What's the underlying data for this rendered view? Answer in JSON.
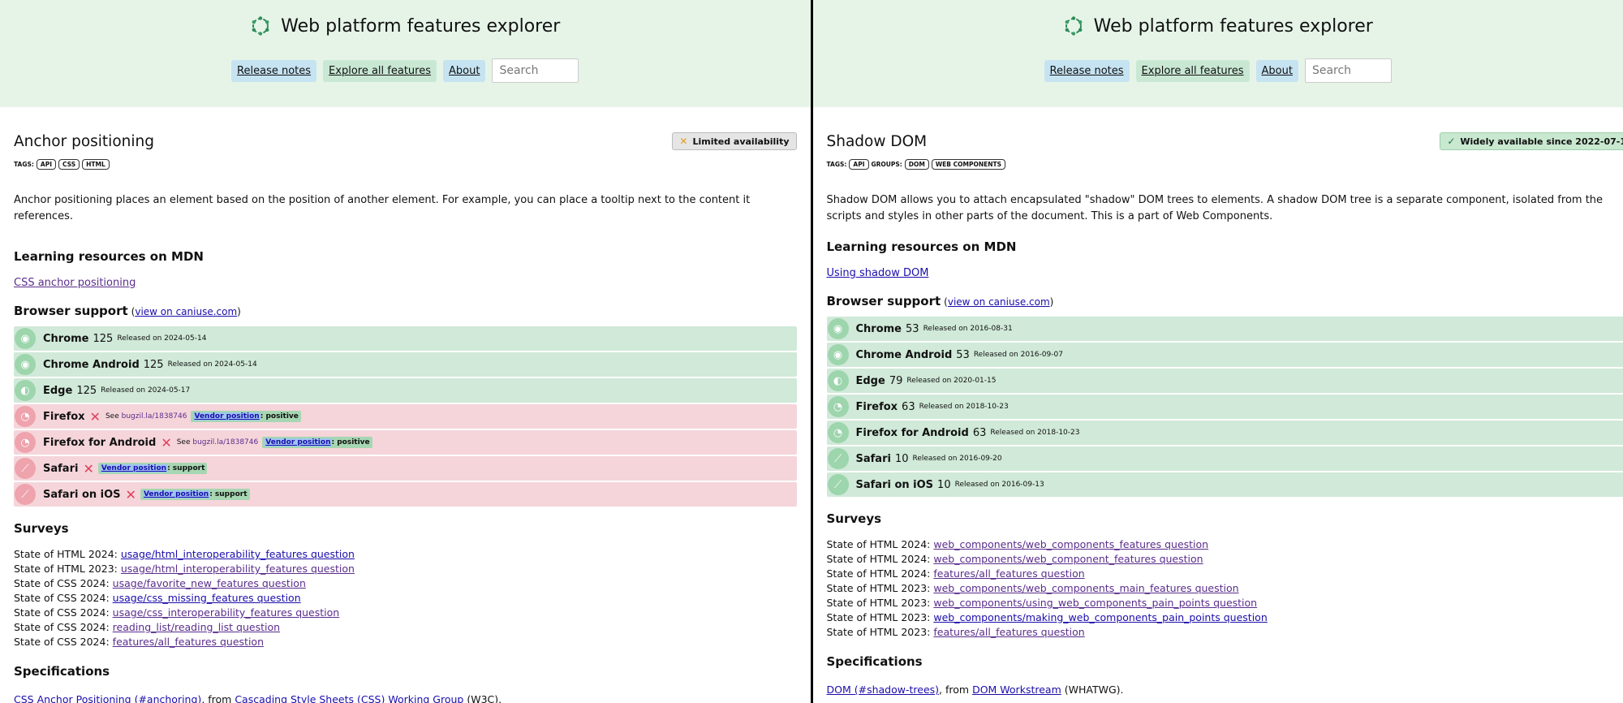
{
  "left": {
    "brand": "Web platform features explorer",
    "nav": {
      "release_notes": "Release notes",
      "explore": "Explore all features",
      "about": "About",
      "search_placeholder": "Search"
    },
    "feature": {
      "title": "Anchor positioning",
      "badge": "Limited availability",
      "tags_label": "TAGS:",
      "tags": [
        "API",
        "CSS",
        "HTML"
      ],
      "description": "Anchor positioning places an element based on the position of another element. For example, you can place a tooltip next to the content it references."
    },
    "mdn": {
      "heading": "Learning resources on MDN",
      "link": "CSS anchor positioning"
    },
    "support": {
      "heading": "Browser support",
      "paren_open": "(",
      "caniuse": "view on caniuse.com",
      "paren_close": ")",
      "browsers": [
        {
          "name": "Chrome",
          "version": "125",
          "released": "Released on 2024-05-14"
        },
        {
          "name": "Chrome Android",
          "version": "125",
          "released": "Released on 2024-05-14"
        },
        {
          "name": "Edge",
          "version": "125",
          "released": "Released on 2024-05-17"
        },
        {
          "name": "Firefox",
          "x": "✕",
          "see": "See",
          "bug": "bugzil.la/1838746",
          "vendor": "Vendor position",
          "position": ": positive"
        },
        {
          "name": "Firefox for Android",
          "x": "✕",
          "see": "See",
          "bug": "bugzil.la/1838746",
          "vendor": "Vendor position",
          "position": ": positive"
        },
        {
          "name": "Safari",
          "x": "✕",
          "vendor": "Vendor position",
          "position": ": support"
        },
        {
          "name": "Safari on iOS",
          "x": "✕",
          "vendor": "Vendor position",
          "position": ": support"
        }
      ]
    },
    "surveys": {
      "heading": "Surveys",
      "items": [
        {
          "label": "State of HTML 2024:",
          "link": "usage/html_interoperability_features question"
        },
        {
          "label": "State of HTML 2023:",
          "link": "usage/html_interoperability_features question"
        },
        {
          "label": "State of CSS 2024:",
          "link": "usage/favorite_new_features question"
        },
        {
          "label": "State of CSS 2024:",
          "link": "usage/css_missing_features question"
        },
        {
          "label": "State of CSS 2024:",
          "link": "usage/css_interoperability_features question"
        },
        {
          "label": "State of CSS 2024:",
          "link": "reading_list/reading_list question"
        },
        {
          "label": "State of CSS 2024:",
          "link": "features/all_features question"
        }
      ]
    },
    "specs": {
      "heading": "Specifications",
      "link": "CSS Anchor Positioning (#anchoring)",
      "from": ", from",
      "group": "Cascading Style Sheets (CSS) Working Group",
      "org": "(W3C)."
    }
  },
  "right": {
    "brand": "Web platform features explorer",
    "nav": {
      "release_notes": "Release notes",
      "explore": "Explore all features",
      "about": "About",
      "search_placeholder": "Search"
    },
    "feature": {
      "title": "Shadow DOM",
      "badge": "Widely available since 2022-07-1",
      "tags_label": "TAGS:",
      "tags": [
        "API"
      ],
      "groups_label": "GROUPS:",
      "groups": [
        "DOM",
        "WEB COMPONENTS"
      ],
      "description": "Shadow DOM allows you to attach encapsulated \"shadow\" DOM trees to elements. A shadow DOM tree is a separate component, isolated from the scripts and styles in other parts of the document. This is a part of Web Components."
    },
    "mdn": {
      "heading": "Learning resources on MDN",
      "link": "Using shadow DOM"
    },
    "support": {
      "heading": "Browser support",
      "paren_open": "(",
      "caniuse": "view on caniuse.com",
      "paren_close": ")",
      "browsers": [
        {
          "name": "Chrome",
          "version": "53",
          "released": "Released on 2016-08-31"
        },
        {
          "name": "Chrome Android",
          "version": "53",
          "released": "Released on 2016-09-07"
        },
        {
          "name": "Edge",
          "version": "79",
          "released": "Released on 2020-01-15"
        },
        {
          "name": "Firefox",
          "version": "63",
          "released": "Released on 2018-10-23"
        },
        {
          "name": "Firefox for Android",
          "version": "63",
          "released": "Released on 2018-10-23"
        },
        {
          "name": "Safari",
          "version": "10",
          "released": "Released on 2016-09-20"
        },
        {
          "name": "Safari on iOS",
          "version": "10",
          "released": "Released on 2016-09-13"
        }
      ]
    },
    "surveys": {
      "heading": "Surveys",
      "items": [
        {
          "label": "State of HTML 2024:",
          "link": "web_components/web_components_features question"
        },
        {
          "label": "State of HTML 2024:",
          "link": "web_components/web_component_features question"
        },
        {
          "label": "State of HTML 2024:",
          "link": "features/all_features question"
        },
        {
          "label": "State of HTML 2023:",
          "link": "web_components/web_components_main_features question"
        },
        {
          "label": "State of HTML 2023:",
          "link": "web_components/using_web_components_pain_points question"
        },
        {
          "label": "State of HTML 2023:",
          "link": "web_components/making_web_components_pain_points question"
        },
        {
          "label": "State of HTML 2023:",
          "link": "features/all_features question"
        }
      ]
    },
    "specs": {
      "heading": "Specifications",
      "link": "DOM (#shadow-trees)",
      "from": ", from",
      "group": "DOM Workstream",
      "org": "(WHATWG)."
    }
  }
}
